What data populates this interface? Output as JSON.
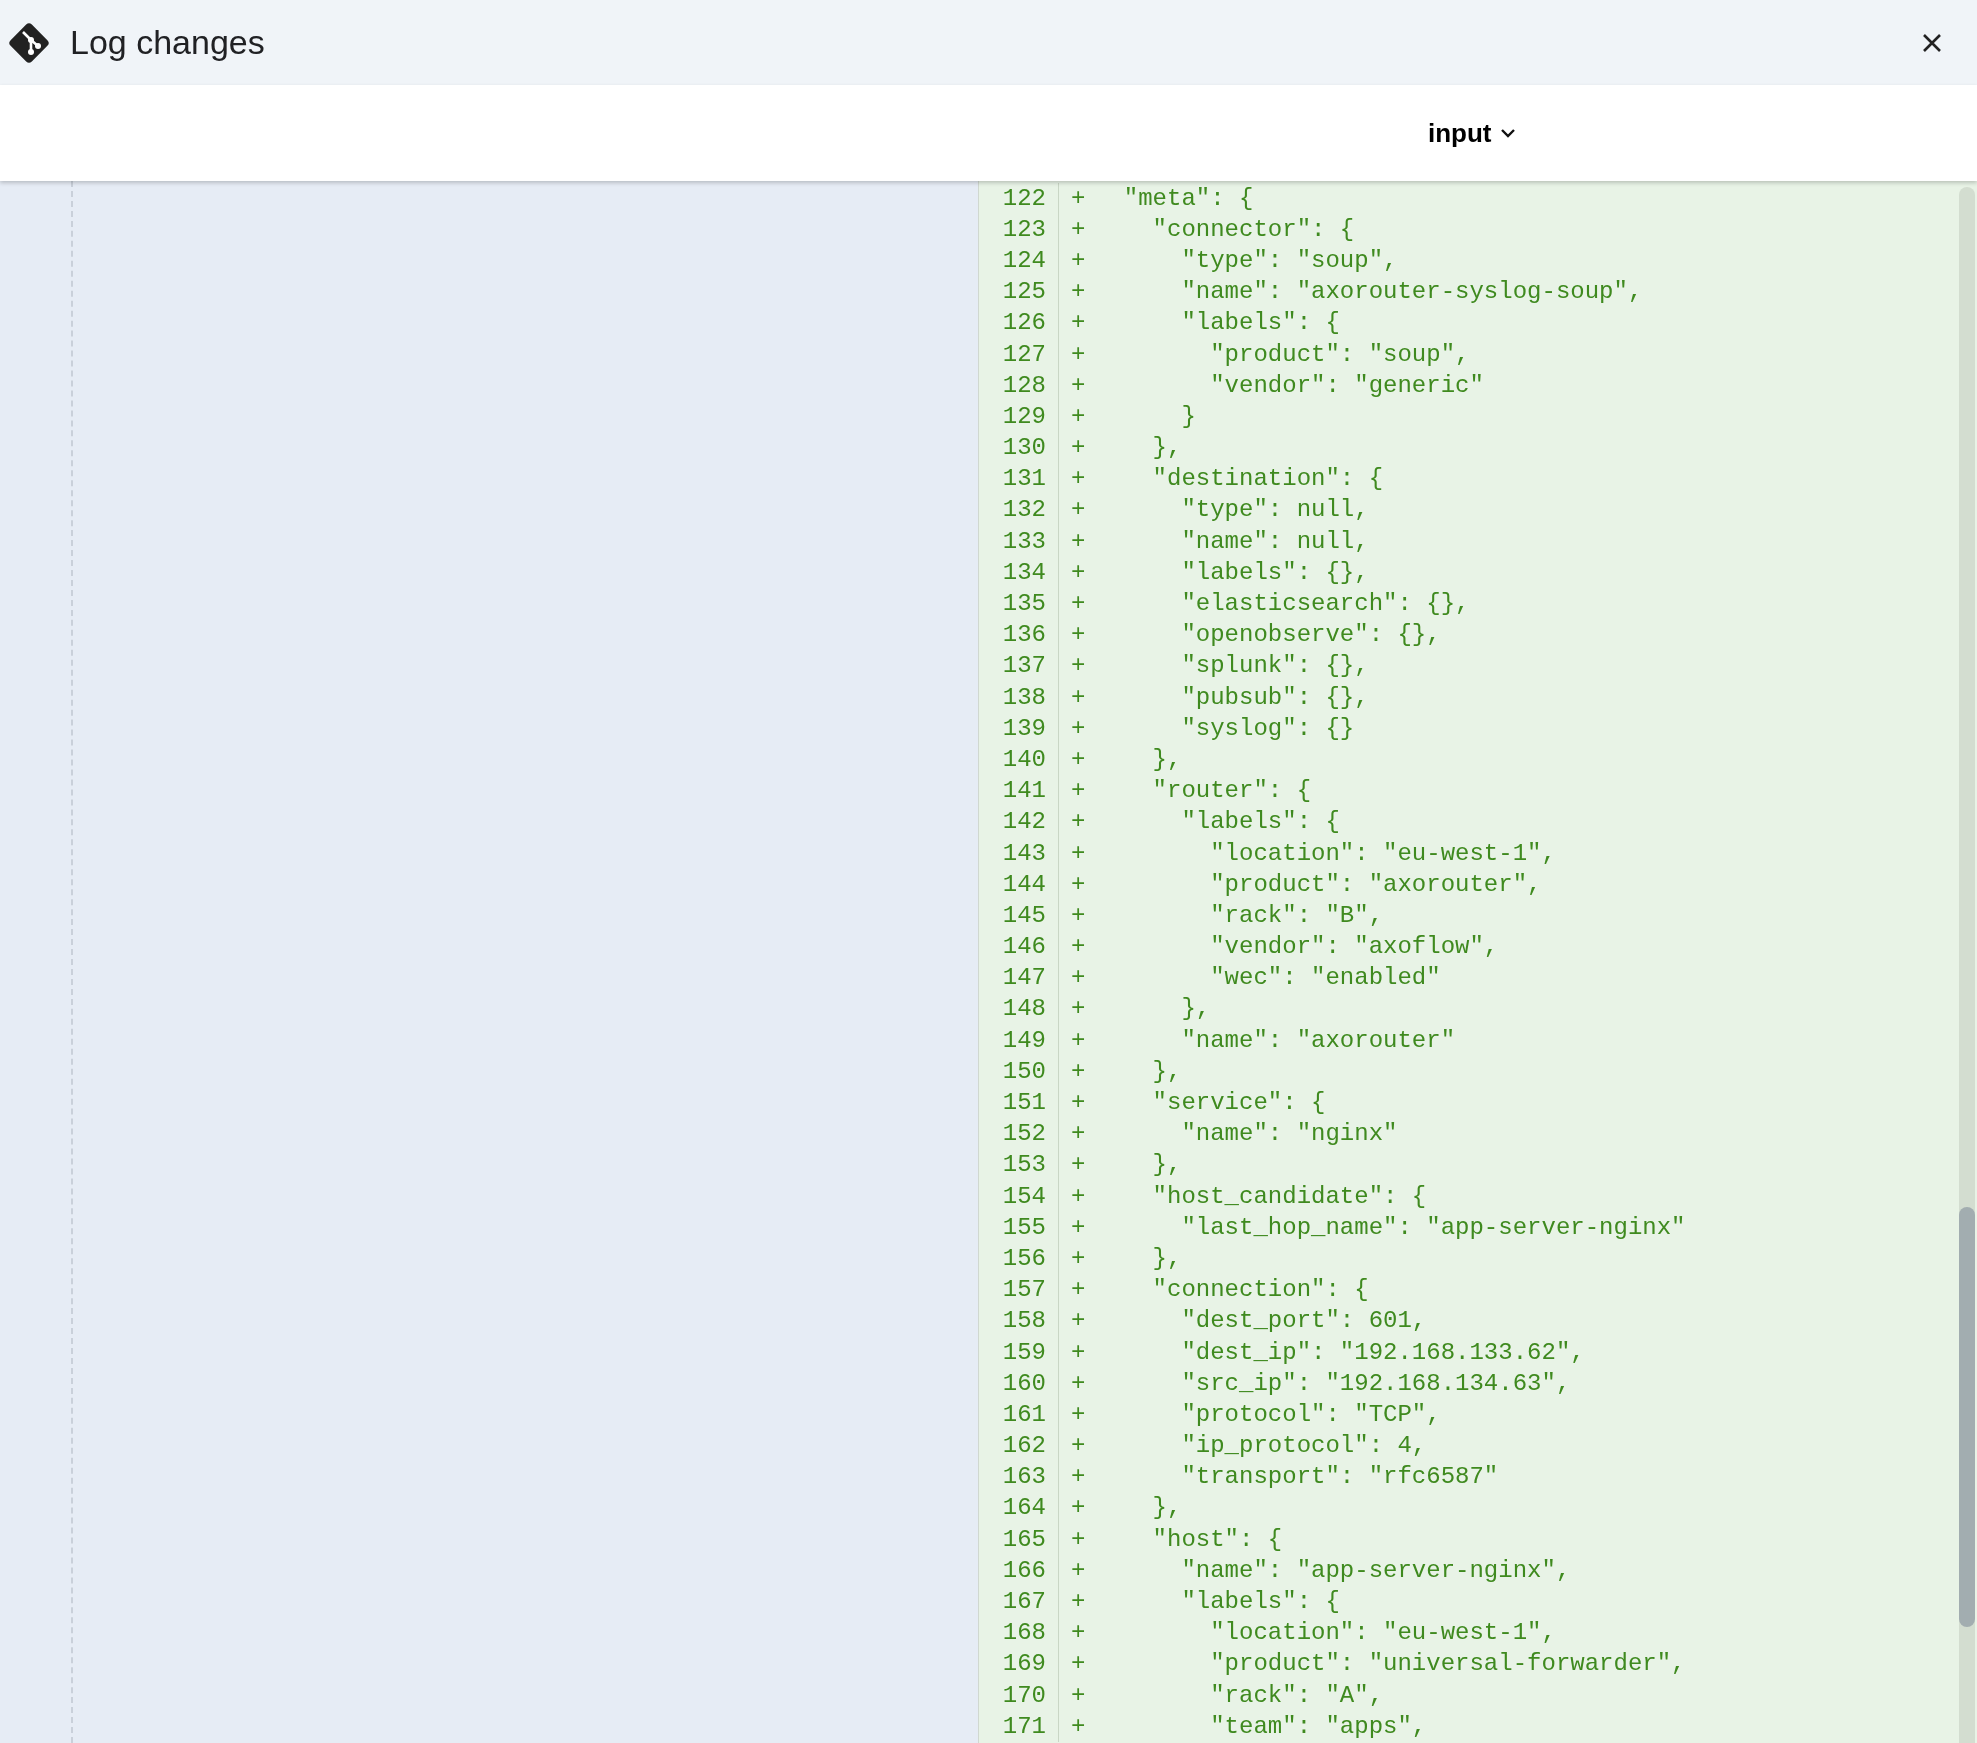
{
  "dialog": {
    "title": "Log changes"
  },
  "view_selector": {
    "label": "input"
  },
  "diff": {
    "lines": [
      {
        "number": "122",
        "marker": "+",
        "kind": "added",
        "text": "  \"meta\": {"
      },
      {
        "number": "123",
        "marker": "+",
        "kind": "added",
        "text": "    \"connector\": {"
      },
      {
        "number": "124",
        "marker": "+",
        "kind": "added",
        "text": "      \"type\": \"soup\","
      },
      {
        "number": "125",
        "marker": "+",
        "kind": "added",
        "text": "      \"name\": \"axorouter-syslog-soup\","
      },
      {
        "number": "126",
        "marker": "+",
        "kind": "added",
        "text": "      \"labels\": {"
      },
      {
        "number": "127",
        "marker": "+",
        "kind": "added",
        "text": "        \"product\": \"soup\","
      },
      {
        "number": "128",
        "marker": "+",
        "kind": "added",
        "text": "        \"vendor\": \"generic\""
      },
      {
        "number": "129",
        "marker": "+",
        "kind": "added",
        "text": "      }"
      },
      {
        "number": "130",
        "marker": "+",
        "kind": "added",
        "text": "    },"
      },
      {
        "number": "131",
        "marker": "+",
        "kind": "added",
        "text": "    \"destination\": {"
      },
      {
        "number": "132",
        "marker": "+",
        "kind": "added",
        "text": "      \"type\": null,"
      },
      {
        "number": "133",
        "marker": "+",
        "kind": "added",
        "text": "      \"name\": null,"
      },
      {
        "number": "134",
        "marker": "+",
        "kind": "added",
        "text": "      \"labels\": {},"
      },
      {
        "number": "135",
        "marker": "+",
        "kind": "added",
        "text": "      \"elasticsearch\": {},"
      },
      {
        "number": "136",
        "marker": "+",
        "kind": "added",
        "text": "      \"openobserve\": {},"
      },
      {
        "number": "137",
        "marker": "+",
        "kind": "added",
        "text": "      \"splunk\": {},"
      },
      {
        "number": "138",
        "marker": "+",
        "kind": "added",
        "text": "      \"pubsub\": {},"
      },
      {
        "number": "139",
        "marker": "+",
        "kind": "added",
        "text": "      \"syslog\": {}"
      },
      {
        "number": "140",
        "marker": "+",
        "kind": "added",
        "text": "    },"
      },
      {
        "number": "141",
        "marker": "+",
        "kind": "added",
        "text": "    \"router\": {"
      },
      {
        "number": "142",
        "marker": "+",
        "kind": "added",
        "text": "      \"labels\": {"
      },
      {
        "number": "143",
        "marker": "+",
        "kind": "added",
        "text": "        \"location\": \"eu-west-1\","
      },
      {
        "number": "144",
        "marker": "+",
        "kind": "added",
        "text": "        \"product\": \"axorouter\","
      },
      {
        "number": "145",
        "marker": "+",
        "kind": "added",
        "text": "        \"rack\": \"B\","
      },
      {
        "number": "146",
        "marker": "+",
        "kind": "added",
        "text": "        \"vendor\": \"axoflow\","
      },
      {
        "number": "147",
        "marker": "+",
        "kind": "added",
        "text": "        \"wec\": \"enabled\""
      },
      {
        "number": "148",
        "marker": "+",
        "kind": "added",
        "text": "      },"
      },
      {
        "number": "149",
        "marker": "+",
        "kind": "added",
        "text": "      \"name\": \"axorouter\""
      },
      {
        "number": "150",
        "marker": "+",
        "kind": "added",
        "text": "    },"
      },
      {
        "number": "151",
        "marker": "+",
        "kind": "added",
        "text": "    \"service\": {"
      },
      {
        "number": "152",
        "marker": "+",
        "kind": "added",
        "text": "      \"name\": \"nginx\""
      },
      {
        "number": "153",
        "marker": "+",
        "kind": "added",
        "text": "    },"
      },
      {
        "number": "154",
        "marker": "+",
        "kind": "added",
        "text": "    \"host_candidate\": {"
      },
      {
        "number": "155",
        "marker": "+",
        "kind": "added",
        "text": "      \"last_hop_name\": \"app-server-nginx\""
      },
      {
        "number": "156",
        "marker": "+",
        "kind": "added",
        "text": "    },"
      },
      {
        "number": "157",
        "marker": "+",
        "kind": "added",
        "text": "    \"connection\": {"
      },
      {
        "number": "158",
        "marker": "+",
        "kind": "added",
        "text": "      \"dest_port\": 601,"
      },
      {
        "number": "159",
        "marker": "+",
        "kind": "added",
        "text": "      \"dest_ip\": \"192.168.133.62\","
      },
      {
        "number": "160",
        "marker": "+",
        "kind": "added",
        "text": "      \"src_ip\": \"192.168.134.63\","
      },
      {
        "number": "161",
        "marker": "+",
        "kind": "added",
        "text": "      \"protocol\": \"TCP\","
      },
      {
        "number": "162",
        "marker": "+",
        "kind": "added",
        "text": "      \"ip_protocol\": 4,"
      },
      {
        "number": "163",
        "marker": "+",
        "kind": "added",
        "text": "      \"transport\": \"rfc6587\""
      },
      {
        "number": "164",
        "marker": "+",
        "kind": "added",
        "text": "    },"
      },
      {
        "number": "165",
        "marker": "+",
        "kind": "added",
        "text": "    \"host\": {"
      },
      {
        "number": "166",
        "marker": "+",
        "kind": "added",
        "text": "      \"name\": \"app-server-nginx\","
      },
      {
        "number": "167",
        "marker": "+",
        "kind": "added",
        "text": "      \"labels\": {"
      },
      {
        "number": "168",
        "marker": "+",
        "kind": "added",
        "text": "        \"location\": \"eu-west-1\","
      },
      {
        "number": "169",
        "marker": "+",
        "kind": "added",
        "text": "        \"product\": \"universal-forwarder\","
      },
      {
        "number": "170",
        "marker": "+",
        "kind": "added",
        "text": "        \"rack\": \"A\","
      },
      {
        "number": "171",
        "marker": "+",
        "kind": "added",
        "text": "        \"team\": \"apps\","
      }
    ]
  }
}
